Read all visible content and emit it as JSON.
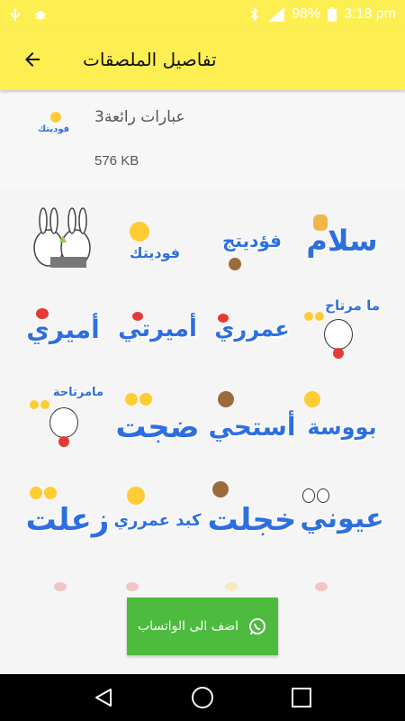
{
  "status_bar": {
    "battery": "98%",
    "time": "3:18 pm"
  },
  "app_bar": {
    "title": "تفاصيل الملصقات",
    "back_icon": "arrow-back-icon"
  },
  "pack": {
    "name": "عبارات رائعة3",
    "size": "576 KB",
    "thumb_text": "فوديتك"
  },
  "stickers": [
    {
      "text": "سلام",
      "emoji": "raised-hand"
    },
    {
      "text": "فؤديتج",
      "emoji": "monkey-kiss"
    },
    {
      "text": "فوديتك",
      "emoji": "heart-eyes"
    },
    {
      "text": "",
      "emoji": "rabbits"
    },
    {
      "text": "ما مرتاح",
      "emoji": "sad-faces"
    },
    {
      "text": "عمرري",
      "emoji": "heart"
    },
    {
      "text": "أميرتي",
      "emoji": "heart"
    },
    {
      "text": "أميري",
      "emoji": "heart"
    },
    {
      "text": "بووسة",
      "emoji": "kiss-face"
    },
    {
      "text": "أستحي",
      "emoji": "monkey"
    },
    {
      "text": "ضجت",
      "emoji": "scream-faces"
    },
    {
      "text": "مامرتاحة",
      "emoji": "sad-faces"
    },
    {
      "text": "عيوني",
      "emoji": "eyes"
    },
    {
      "text": "خجلت",
      "emoji": "monkey"
    },
    {
      "text": "كبد عمرري",
      "emoji": "heart-eyes"
    },
    {
      "text": "زعلت",
      "emoji": "sad-faces"
    }
  ],
  "add_button": {
    "label": "اضف الى الواتساب",
    "icon": "whatsapp-icon"
  },
  "colors": {
    "accent": "#fdef52",
    "sticker_text": "#2e6fe0",
    "button": "#4cbb3e"
  }
}
